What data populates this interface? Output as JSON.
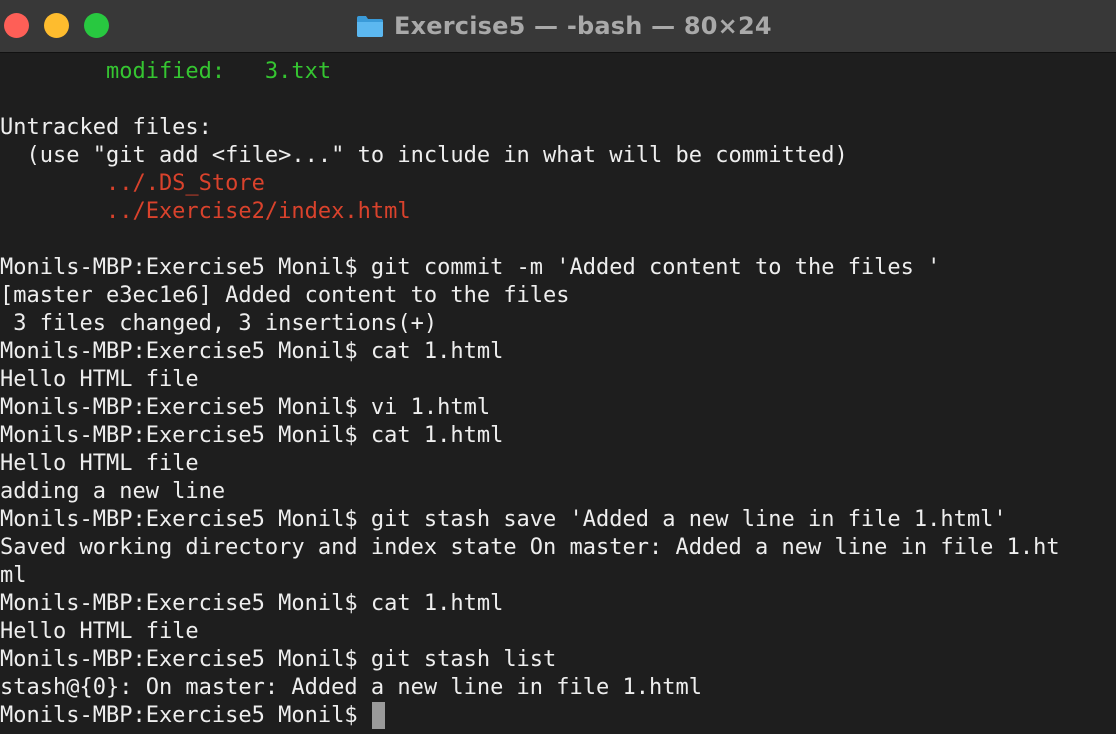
{
  "window": {
    "title": "Exercise5 — -bash — 80×24",
    "folder_icon": "folder-icon",
    "accent_colors": {
      "close": "#fe5f57",
      "minimize": "#febc2e",
      "maximize": "#28c840",
      "output_green": "#35c531",
      "output_red": "#d9422c"
    }
  },
  "terminal": {
    "lines": [
      {
        "text": "        modified:   3.txt",
        "color": "green"
      },
      {
        "text": "",
        "color": "default"
      },
      {
        "text": "Untracked files:",
        "color": "default"
      },
      {
        "text": "  (use \"git add <file>...\" to include in what will be committed)",
        "color": "default"
      },
      {
        "text": "        ../.DS_Store",
        "color": "red"
      },
      {
        "text": "        ../Exercise2/index.html",
        "color": "red"
      },
      {
        "text": "",
        "color": "default"
      },
      {
        "text": "Monils-MBP:Exercise5 Monil$ git commit -m 'Added content to the files '",
        "color": "default"
      },
      {
        "text": "[master e3ec1e6] Added content to the files",
        "color": "default"
      },
      {
        "text": " 3 files changed, 3 insertions(+)",
        "color": "default"
      },
      {
        "text": "Monils-MBP:Exercise5 Monil$ cat 1.html",
        "color": "default"
      },
      {
        "text": "Hello HTML file",
        "color": "default"
      },
      {
        "text": "Monils-MBP:Exercise5 Monil$ vi 1.html",
        "color": "default"
      },
      {
        "text": "Monils-MBP:Exercise5 Monil$ cat 1.html",
        "color": "default"
      },
      {
        "text": "Hello HTML file",
        "color": "default"
      },
      {
        "text": "adding a new line",
        "color": "default"
      },
      {
        "text": "Monils-MBP:Exercise5 Monil$ git stash save 'Added a new line in file 1.html'",
        "color": "default"
      },
      {
        "text": "Saved working directory and index state On master: Added a new line in file 1.ht",
        "color": "default"
      },
      {
        "text": "ml",
        "color": "default"
      },
      {
        "text": "Monils-MBP:Exercise5 Monil$ cat 1.html",
        "color": "default"
      },
      {
        "text": "Hello HTML file",
        "color": "default"
      },
      {
        "text": "Monils-MBP:Exercise5 Monil$ git stash list",
        "color": "default"
      },
      {
        "text": "stash@{0}: On master: Added a new line in file 1.html",
        "color": "default"
      }
    ],
    "prompt": "Monils-MBP:Exercise5 Monil$ "
  }
}
